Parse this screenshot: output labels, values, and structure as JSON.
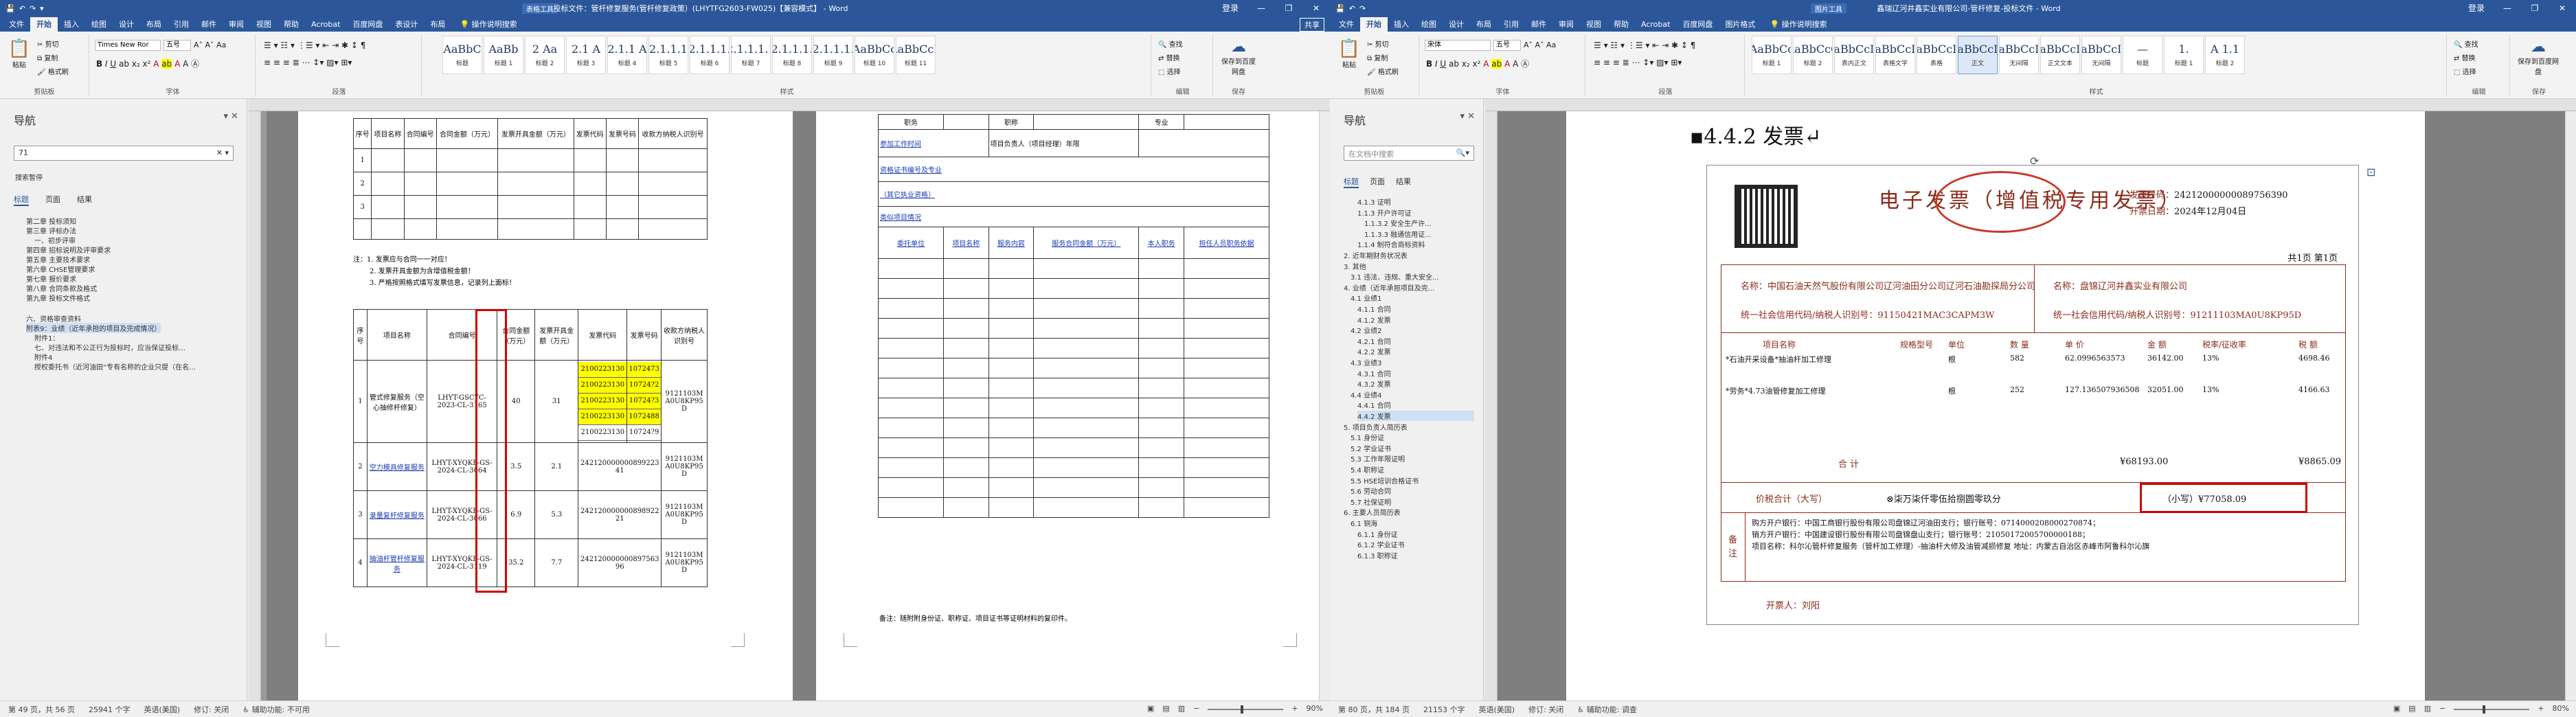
{
  "w1": {
    "title": "投标文件：管杆修复服务(管杆修复政策）(LHYTFG2603-FW025)【兼容模式】 - Word",
    "table_tools": "表格工具",
    "qat": [
      "💾",
      "↶",
      "↷",
      "▾"
    ],
    "controls": [
      "登录",
      "—",
      "❐",
      "✕"
    ],
    "tabs": [
      "文件",
      "开始",
      "插入",
      "绘图",
      "设计",
      "布局",
      "引用",
      "邮件",
      "审阅",
      "视图",
      "帮助",
      "Acrobat",
      "百度网盘",
      "表设计",
      "布局"
    ],
    "tellme": "操作说明搜索",
    "share": "共享",
    "clipboard": {
      "paste": "粘贴",
      "cut": "剪切",
      "copy": "复制",
      "painter": "格式刷",
      "group": "剪贴板"
    },
    "font": {
      "name": "Times New Ror",
      "size": "五号",
      "group": "字体"
    },
    "paragraph": {
      "group": "段落"
    },
    "styles": [
      {
        "prev": "AaBbC",
        "name": "标题"
      },
      {
        "prev": "AaBb",
        "name": "标题 1"
      },
      {
        "prev": "2 Aa",
        "name": "标题 2"
      },
      {
        "prev": "2.1 A",
        "name": "标题 3"
      },
      {
        "prev": "2.1.1 A",
        "name": "标题 4"
      },
      {
        "prev": "2.1.1.1",
        "name": "标题 5"
      },
      {
        "prev": "2.1.1.1.",
        "name": "标题 6"
      },
      {
        "prev": "2.1.1.1.1",
        "name": "标题 7"
      },
      {
        "prev": "2.1.1.1.",
        "name": "标题 8"
      },
      {
        "prev": "2.1.1.1.",
        "name": "标题 9"
      },
      {
        "prev": "AaBbCc",
        "name": "标题 10"
      },
      {
        "prev": "AaBbCcE",
        "name": "标题 11"
      }
    ],
    "styles_group": "样式",
    "editing": {
      "find": "查找",
      "replace": "替换",
      "select": "选择",
      "group": "编辑"
    },
    "save_baidu": {
      "label": "保存到百度网盘",
      "group": "保存"
    },
    "nav": {
      "title": "导航",
      "search": "71",
      "tabs": [
        "标题",
        "页面",
        "结果"
      ],
      "result_label": "搜索暂停",
      "items": [
        "第二章 投标须知",
        "第三章 评标办法",
        "一、初步评审",
        "第四章 招标说明及评审要求",
        "第五章 主要技术要求",
        "第六章 CHSE管理要求",
        "第七章 报价要求",
        "第八章 合同条款及格式",
        "第九章 投标文件格式",
        "六、资格审查资料",
        "附表9：业绩（近年承担的项目及完成情况）",
        "附件1：",
        "七、对违法和不公正行为投标时，应当保证投标…",
        "附件4",
        "授权委托书（近河油田“专有名称的企业只提（在名…"
      ]
    },
    "doc": {
      "top_headers": [
        "序号",
        "项目名称",
        "合同编号",
        "合同金额（万元）",
        "发票开具金额（万元）",
        "发票代码",
        "发票号码",
        "收款方纳税人识别号"
      ],
      "top_rows": [
        "1",
        "2",
        "3"
      ],
      "notes": [
        "注：1. 发票应与合同一一对应！",
        "2. 发票开具金额为含增值税金额！",
        "3. 严格按照格式填写发票信息，记录列上面标！"
      ],
      "bot_headers": [
        "序号",
        "项目名称",
        "合同编号",
        "合同金额（万元）",
        "发票开具金额（万元）",
        "发票代码",
        "发票号码",
        "收款方纳税人识别号"
      ],
      "rows": [
        {
          "no": "1",
          "name": "管式修复服务（空心抽修杆修复）",
          "contract": "LHYT-GSCYC-2023-CL-3165",
          "amount": "40",
          "inv": "31",
          "codes": [
            "2100223130",
            "2100223130",
            "2100223130",
            "2100223130",
            "2100223130"
          ],
          "nums": [
            "1072473",
            "10724?2",
            "10724?3",
            "1072488",
            "10724?9"
          ],
          "taxid": "9121103MA0U8KP95D"
        },
        {
          "no": "2",
          "name": "空力模具修复服务",
          "contract": "LHYT-XYQKF-GS-2024-CL-3064",
          "amount": "3.5",
          "inv": "2.1",
          "code": "24212000000089922341",
          "taxid": "9121103MA0U8KP95D"
        },
        {
          "no": "3",
          "name": "录量复杆修复服务",
          "contract": "LHYT-XYQKF-GS-2024-CL-3066",
          "amount": "6.9",
          "inv": "5.3",
          "code": "24212000000089892221",
          "taxid": "9121103MA0U8KP95D"
        },
        {
          "no": "4",
          "name": "抽油杆管杆修复服务",
          "contract": "LHYT-XYQKF-GS-2024-CL-3119",
          "amount": "35.2",
          "inv": "7.7",
          "code": "24212000000089756396",
          "taxid": "9121103MA0U8KP95D"
        }
      ],
      "p2_top": [
        "职务",
        "职称",
        "专业"
      ],
      "p2_labels": [
        "参加工作时间",
        "项目负责人（项目经理）年限",
        "资格证书编号及专业",
        "（其它执业资格）",
        "类似项目情况"
      ],
      "p2_headers": [
        "委托单位",
        "项目名称",
        "服务内容",
        "服务合同金额（万元）",
        "本人职务",
        "担任人员职务依据"
      ],
      "p2_note": "备注：随附附身份证、职称证、项目证书等证明材料的复印件。"
    },
    "status": {
      "page": "第 49 页，共 56 页",
      "words": "25941 个字",
      "lang": "英语(美国)",
      "track": "修订: 关闭",
      "access": "辅助功能: 不可用",
      "zoom": "90%"
    }
  },
  "w2": {
    "title": "鑫瑞辽河井鑫实业有限公司-管杆修复-投标文件 - Word",
    "pic_tools": "图片工具",
    "controls": [
      "登录",
      "—",
      "❐",
      "✕"
    ],
    "tabs": [
      "文件",
      "开始",
      "插入",
      "绘图",
      "设计",
      "布局",
      "引用",
      "邮件",
      "审阅",
      "视图",
      "帮助",
      "Acrobat",
      "百度网盘",
      "图片格式"
    ],
    "tellme": "操作说明搜索",
    "clipboard": {
      "paste": "粘贴",
      "cut": "剪切",
      "copy": "复制",
      "painter": "格式刷",
      "group": "剪贴板"
    },
    "font": {
      "name": "宋体",
      "size": "五号",
      "group": "字体"
    },
    "paragraph": {
      "group": "段落"
    },
    "styles": [
      {
        "prev": "AaBbCc",
        "name": "标题 1"
      },
      {
        "prev": "AaBbCcC",
        "name": "标题 2"
      },
      {
        "prev": "AaBbCcDi",
        "name": "表内正文"
      },
      {
        "prev": "AaBbCcDi",
        "name": "表格文字"
      },
      {
        "prev": "AaBbCcDi",
        "name": "表格"
      },
      {
        "prev": "AaBbCcDi",
        "name": "正文"
      },
      {
        "prev": "AaBbCcDi",
        "name": "无间隔"
      },
      {
        "prev": "AaBbCcDi",
        "name": "正文文本"
      },
      {
        "prev": "AaBbCcDi",
        "name": "无间隔"
      },
      {
        "prev": "—",
        "name": "标题"
      },
      {
        "prev": "1.",
        "name": "标题 1"
      },
      {
        "prev": "A 1.1",
        "name": "标题 2"
      }
    ],
    "styles_group": "样式",
    "editing": {
      "find": "查找",
      "replace": "替换",
      "select": "选择",
      "group": "编辑"
    },
    "save_baidu": {
      "label": "保存到百度网盘",
      "group": "保存"
    },
    "nav": {
      "title": "导航",
      "search": "在文档中搜索",
      "tabs": [
        "标题",
        "页面",
        "结果"
      ],
      "items": [
        "4.1.3 证明",
        "1.1.3 开户许可证",
        "1.1.3.2 安全生产许...",
        "1.1.3.3 融通信用证...",
        "1.1.4 制符合商标资料",
        "2. 近年期财务状况表",
        "3. 其他",
        "3.1 违法、违规、重大安全...",
        "4. 业绩（近年承担项目及完...",
        "4.1 业绩1",
        "4.1.1 合同",
        "4.1.2 发票",
        "4.2 业绩2",
        "4.2.1 合同",
        "4.2.2 发票",
        "4.3 业绩3",
        "4.3.1 合同",
        "4.3.2 发票",
        "4.4 业绩4",
        "4.4.1 合同",
        "4.4.2 发票",
        "5. 项目负责人简历表",
        "5.1 身份证",
        "5.2 学业证书",
        "5.3 工作年限证明",
        "5.4 职称证",
        "5.5 HSE培训合格证书",
        "5.6 劳动合同",
        "5.7 社保证明",
        "6. 主要人员简历表",
        "6.1 铜海",
        "6.1.1 身份证",
        "6.1.2 学业证书",
        "6.1.3 职称证"
      ]
    },
    "doc": {
      "heading": "4.4.2 发票",
      "inv_title": "电子发票（增值税专用发票）",
      "inv_no_label": "发票号码：",
      "inv_no": "24212000000089756390",
      "inv_date_label": "开票日期：",
      "inv_date": "2024年12月04日",
      "page_count": "共1页 第1页",
      "buyer_name": "名称：中国石油天然气股份有限公司辽河油田分公司辽河石油勘探局分公司",
      "buyer_tax": "统一社会信用代码/纳税人识别号：91150421MAC3CAPM3W",
      "seller_name": "名称：盘锦辽河井鑫实业有限公司",
      "seller_tax": "统一社会信用代码/纳税人识别号：91211103MA0U8KP95D",
      "col_heads": [
        "项目名称",
        "规格型号",
        "单位",
        "数 量",
        "单 价",
        "金 额",
        "税率/征收率",
        "税 额"
      ],
      "lines": [
        [
          "*石油开采设备*抽油杆加工修理",
          "",
          "根",
          "582",
          "62.0996563573",
          "36142.00",
          "13%",
          "4698.46"
        ],
        [
          "*劳务*4.73油管修复加工修理",
          "",
          "根",
          "252",
          "127.136507936508",
          "32051.00",
          "13%",
          "4166.63"
        ]
      ],
      "total_label": "合 计",
      "total_amount": "¥68193.00",
      "total_tax": "¥8865.09",
      "sum_label": "价税合计（大写）",
      "sum_words": "⊗柒万柒仟零伍拾捌圆零玖分",
      "sum_small": "（小写）¥77058.09",
      "remarks": [
        "购方开户银行：中国工商银行股份有限公司盘锦辽河油田支行；银行账号：0714000208000270874；",
        "销方开户银行：中国建设银行股份有限公司盘锦盘山支行；银行账号：21050172005700000188；",
        "项目名称：科尔沁管杆修复服务（管杆加工修理）-抽油杆大修及油管减损修复 地址：内蒙古自治区赤峰市阿鲁科尔沁旗"
      ],
      "remark_label": "备注",
      "issuer": "开票人：刘阳"
    },
    "status": {
      "page": "第 80 页，共 184 页",
      "words": "21153 个字",
      "lang": "英语(美国)",
      "track": "修订: 关闭",
      "access": "辅助功能: 调查",
      "zoom": "80%"
    }
  },
  "colors": {
    "word_blue": "#2b579a",
    "highlight": "#ffff00",
    "red_box": "#d00000",
    "invoice_brown": "#8b2b1b"
  }
}
